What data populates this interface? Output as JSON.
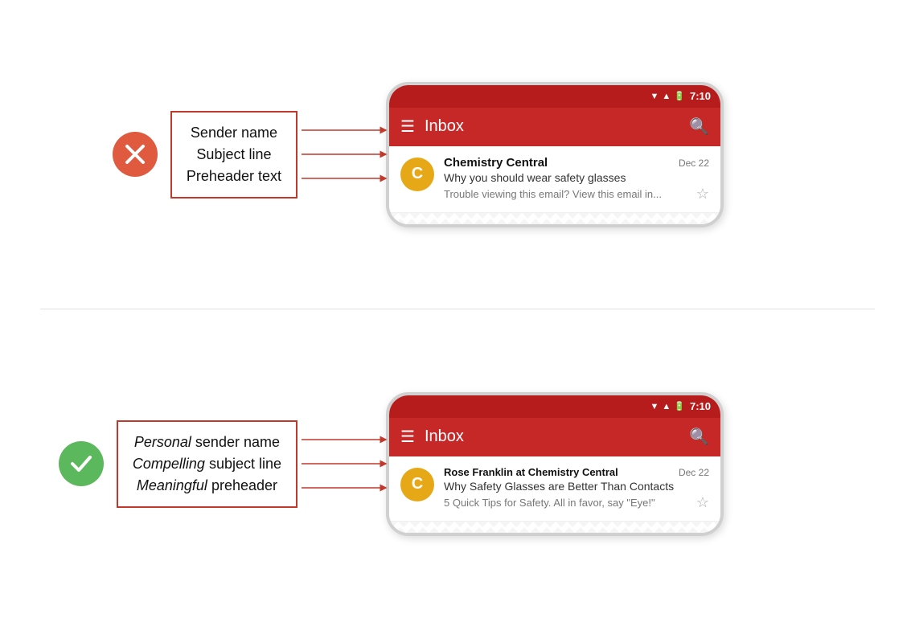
{
  "top": {
    "bad_icon": "✕",
    "annotation": {
      "line1": "Sender name",
      "line2": "Subject line",
      "line3": "Preheader text"
    },
    "phone": {
      "time": "7:10",
      "toolbar_title": "Inbox",
      "email": {
        "avatar_letter": "C",
        "sender": "Chemistry Central",
        "date": "Dec 22",
        "subject": "Why you should wear safety glasses",
        "preheader": "Trouble viewing this email? View this email in...",
        "star": "☆"
      }
    }
  },
  "bottom": {
    "good_icon": "✓",
    "annotation": {
      "line1": "Personal sender name",
      "line2": "Compelling subject line",
      "line3": "Meaningful preheader",
      "italic_word1": "Personal",
      "italic_word2": "Compelling",
      "italic_word3": "Meaningful"
    },
    "phone": {
      "time": "7:10",
      "toolbar_title": "Inbox",
      "email": {
        "avatar_letter": "C",
        "sender": "Rose Franklin at Chemistry Central",
        "date": "Dec 22",
        "subject": "Why Safety Glasses are Better Than Contacts",
        "preheader": "5 Quick Tips for Safety. All in favor, say \"Eye!\"",
        "star": "☆"
      }
    }
  }
}
